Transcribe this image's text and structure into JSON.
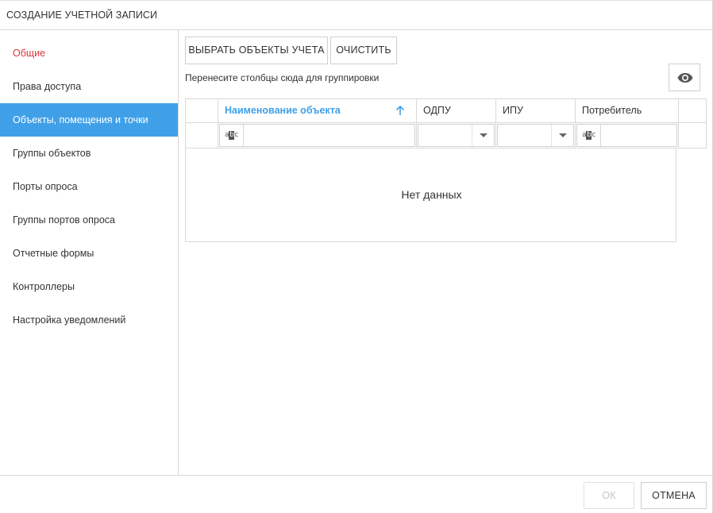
{
  "dialog": {
    "title": "СОЗДАНИЕ УЧЕТНОЙ ЗАПИСИ"
  },
  "sidebar": {
    "items": [
      {
        "label": "Общие",
        "state": "error",
        "color": "#d9363e"
      },
      {
        "label": "Права доступа",
        "state": "normal"
      },
      {
        "label": "Объекты, помещения и точки",
        "state": "active",
        "color": "#3fa0e8"
      },
      {
        "label": "Группы объектов",
        "state": "normal"
      },
      {
        "label": "Порты опроса",
        "state": "normal"
      },
      {
        "label": "Группы портов опроса",
        "state": "normal"
      },
      {
        "label": "Отчетные формы",
        "state": "normal"
      },
      {
        "label": "Контроллеры",
        "state": "normal"
      },
      {
        "label": "Настройка уведомлений",
        "state": "normal"
      }
    ]
  },
  "toolbar": {
    "select_label": "ВЫБРАТЬ ОБЪЕКТЫ УЧЕТА",
    "clear_label": "ОЧИСТИТЬ",
    "column_chooser_icon": "eye-icon"
  },
  "grid": {
    "group_panel_hint": "Перенесите столбцы сюда для группировки",
    "columns": [
      {
        "label": "Наименование объекта",
        "sort": "asc",
        "filter": "text"
      },
      {
        "label": "ОДПУ",
        "filter": "dropdown"
      },
      {
        "label": "ИПУ",
        "filter": "dropdown"
      },
      {
        "label": "Потребитель",
        "filter": "text"
      }
    ],
    "no_data_text": "Нет данных",
    "accent_color": "#3fa0e8"
  },
  "footer": {
    "ok_label": "ОК",
    "ok_enabled": false,
    "cancel_label": "ОТМЕНА"
  }
}
